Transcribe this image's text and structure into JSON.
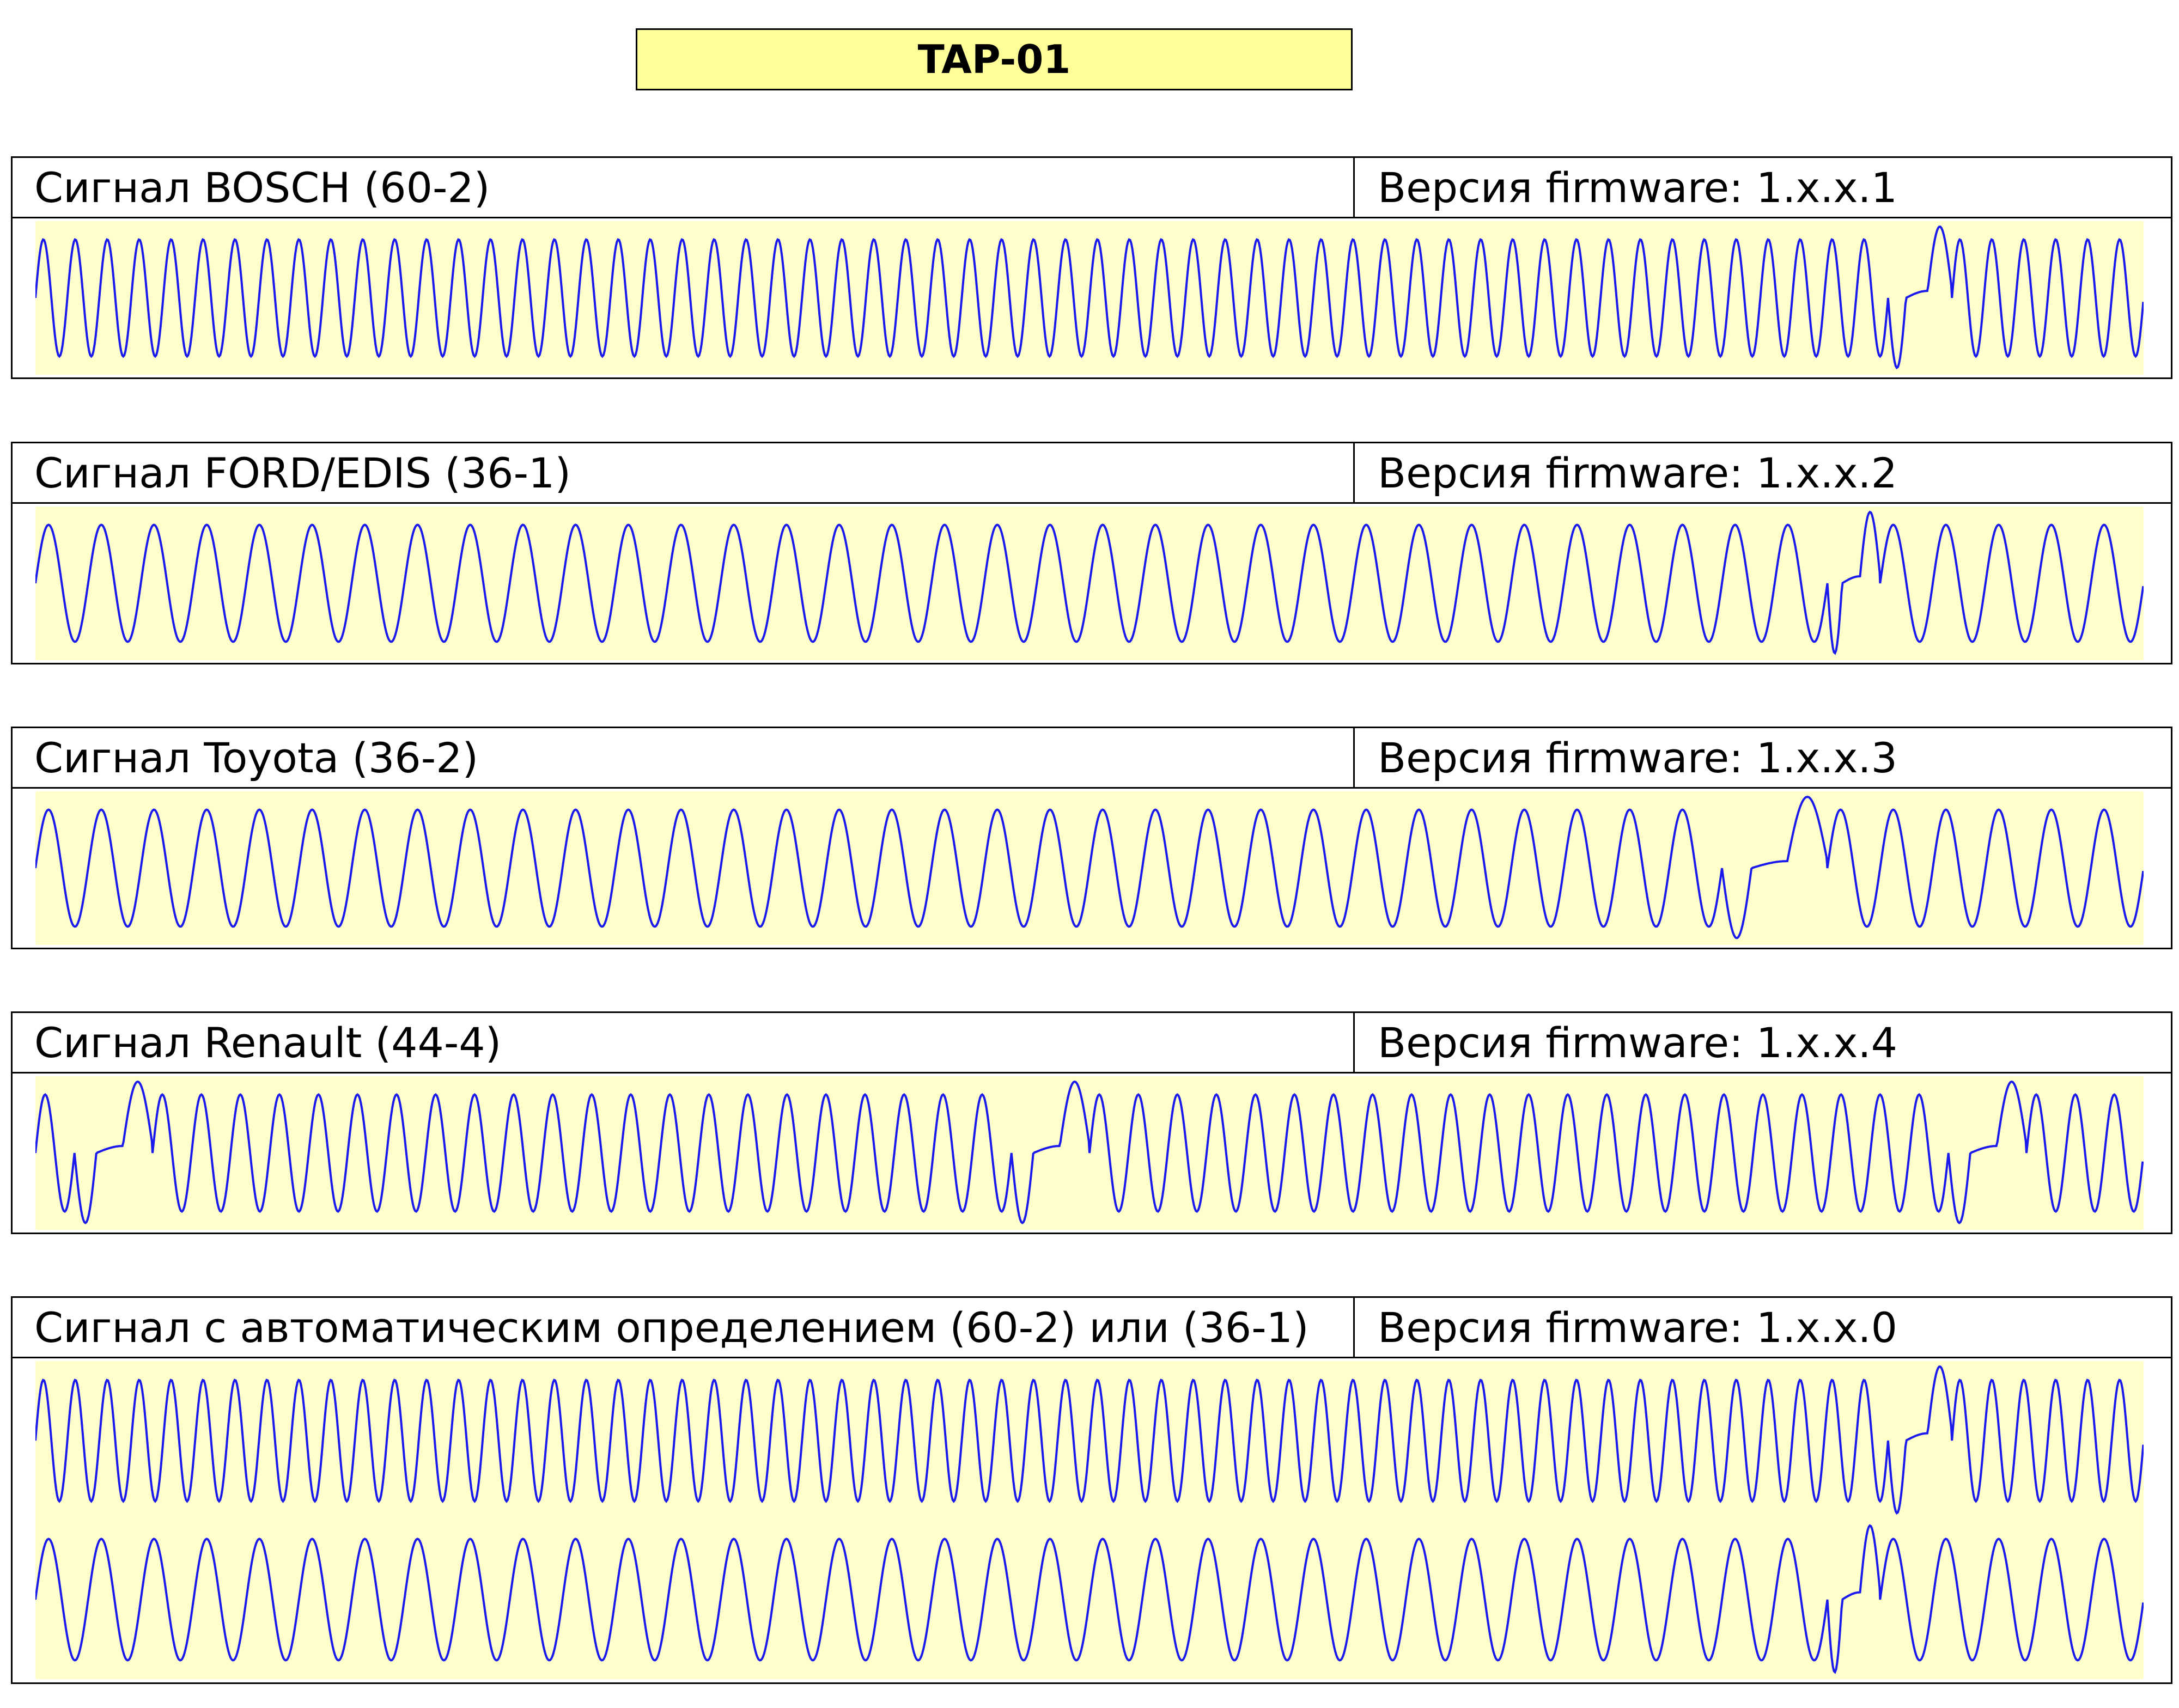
{
  "title": "TAP-01",
  "colors": {
    "title_background": "#ffff99",
    "plot_background": "#ffffcc",
    "waveform": "#1a1aee",
    "border": "#000000"
  },
  "panels": [
    {
      "signal": "Сигнал BOSCH (60-2)",
      "firmware": "Версия firmware: 1.x.x.1",
      "waveforms": [
        {
          "teeth_shown": 64,
          "gap_after_tooth": 58,
          "missing_teeth": 2
        }
      ]
    },
    {
      "signal": "Сигнал FORD/EDIS (36-1)",
      "firmware": "Версия firmware: 1.x.x.2",
      "waveforms": [
        {
          "teeth_shown": 39,
          "gap_after_tooth": 34,
          "missing_teeth": 1
        }
      ]
    },
    {
      "signal": "Сигнал Toyota (36-2)",
      "firmware": "Версия firmware: 1.x.x.3",
      "waveforms": [
        {
          "teeth_shown": 38,
          "gap_after_tooth": 32,
          "missing_teeth": 2
        }
      ]
    },
    {
      "signal": "Сигнал Renault (44-4)",
      "firmware": "Версия firmware: 1.x.x.4",
      "waveforms": [
        {
          "teeth_shown": 48,
          "gaps": [
            {
              "after_tooth": 1,
              "missing_teeth": 2
            },
            {
              "after_tooth": 23,
              "missing_teeth": 2
            },
            {
              "after_tooth": 45,
              "missing_teeth": 2
            }
          ]
        }
      ]
    },
    {
      "signal": "Сигнал с автоматическим определением (60-2) или (36-1)",
      "firmware": "Версия firmware: 1.x.x.0",
      "waveforms": [
        {
          "teeth_shown": 64,
          "gap_after_tooth": 58,
          "missing_teeth": 2
        },
        {
          "teeth_shown": 39,
          "gap_after_tooth": 34,
          "missing_teeth": 1
        }
      ]
    }
  ]
}
